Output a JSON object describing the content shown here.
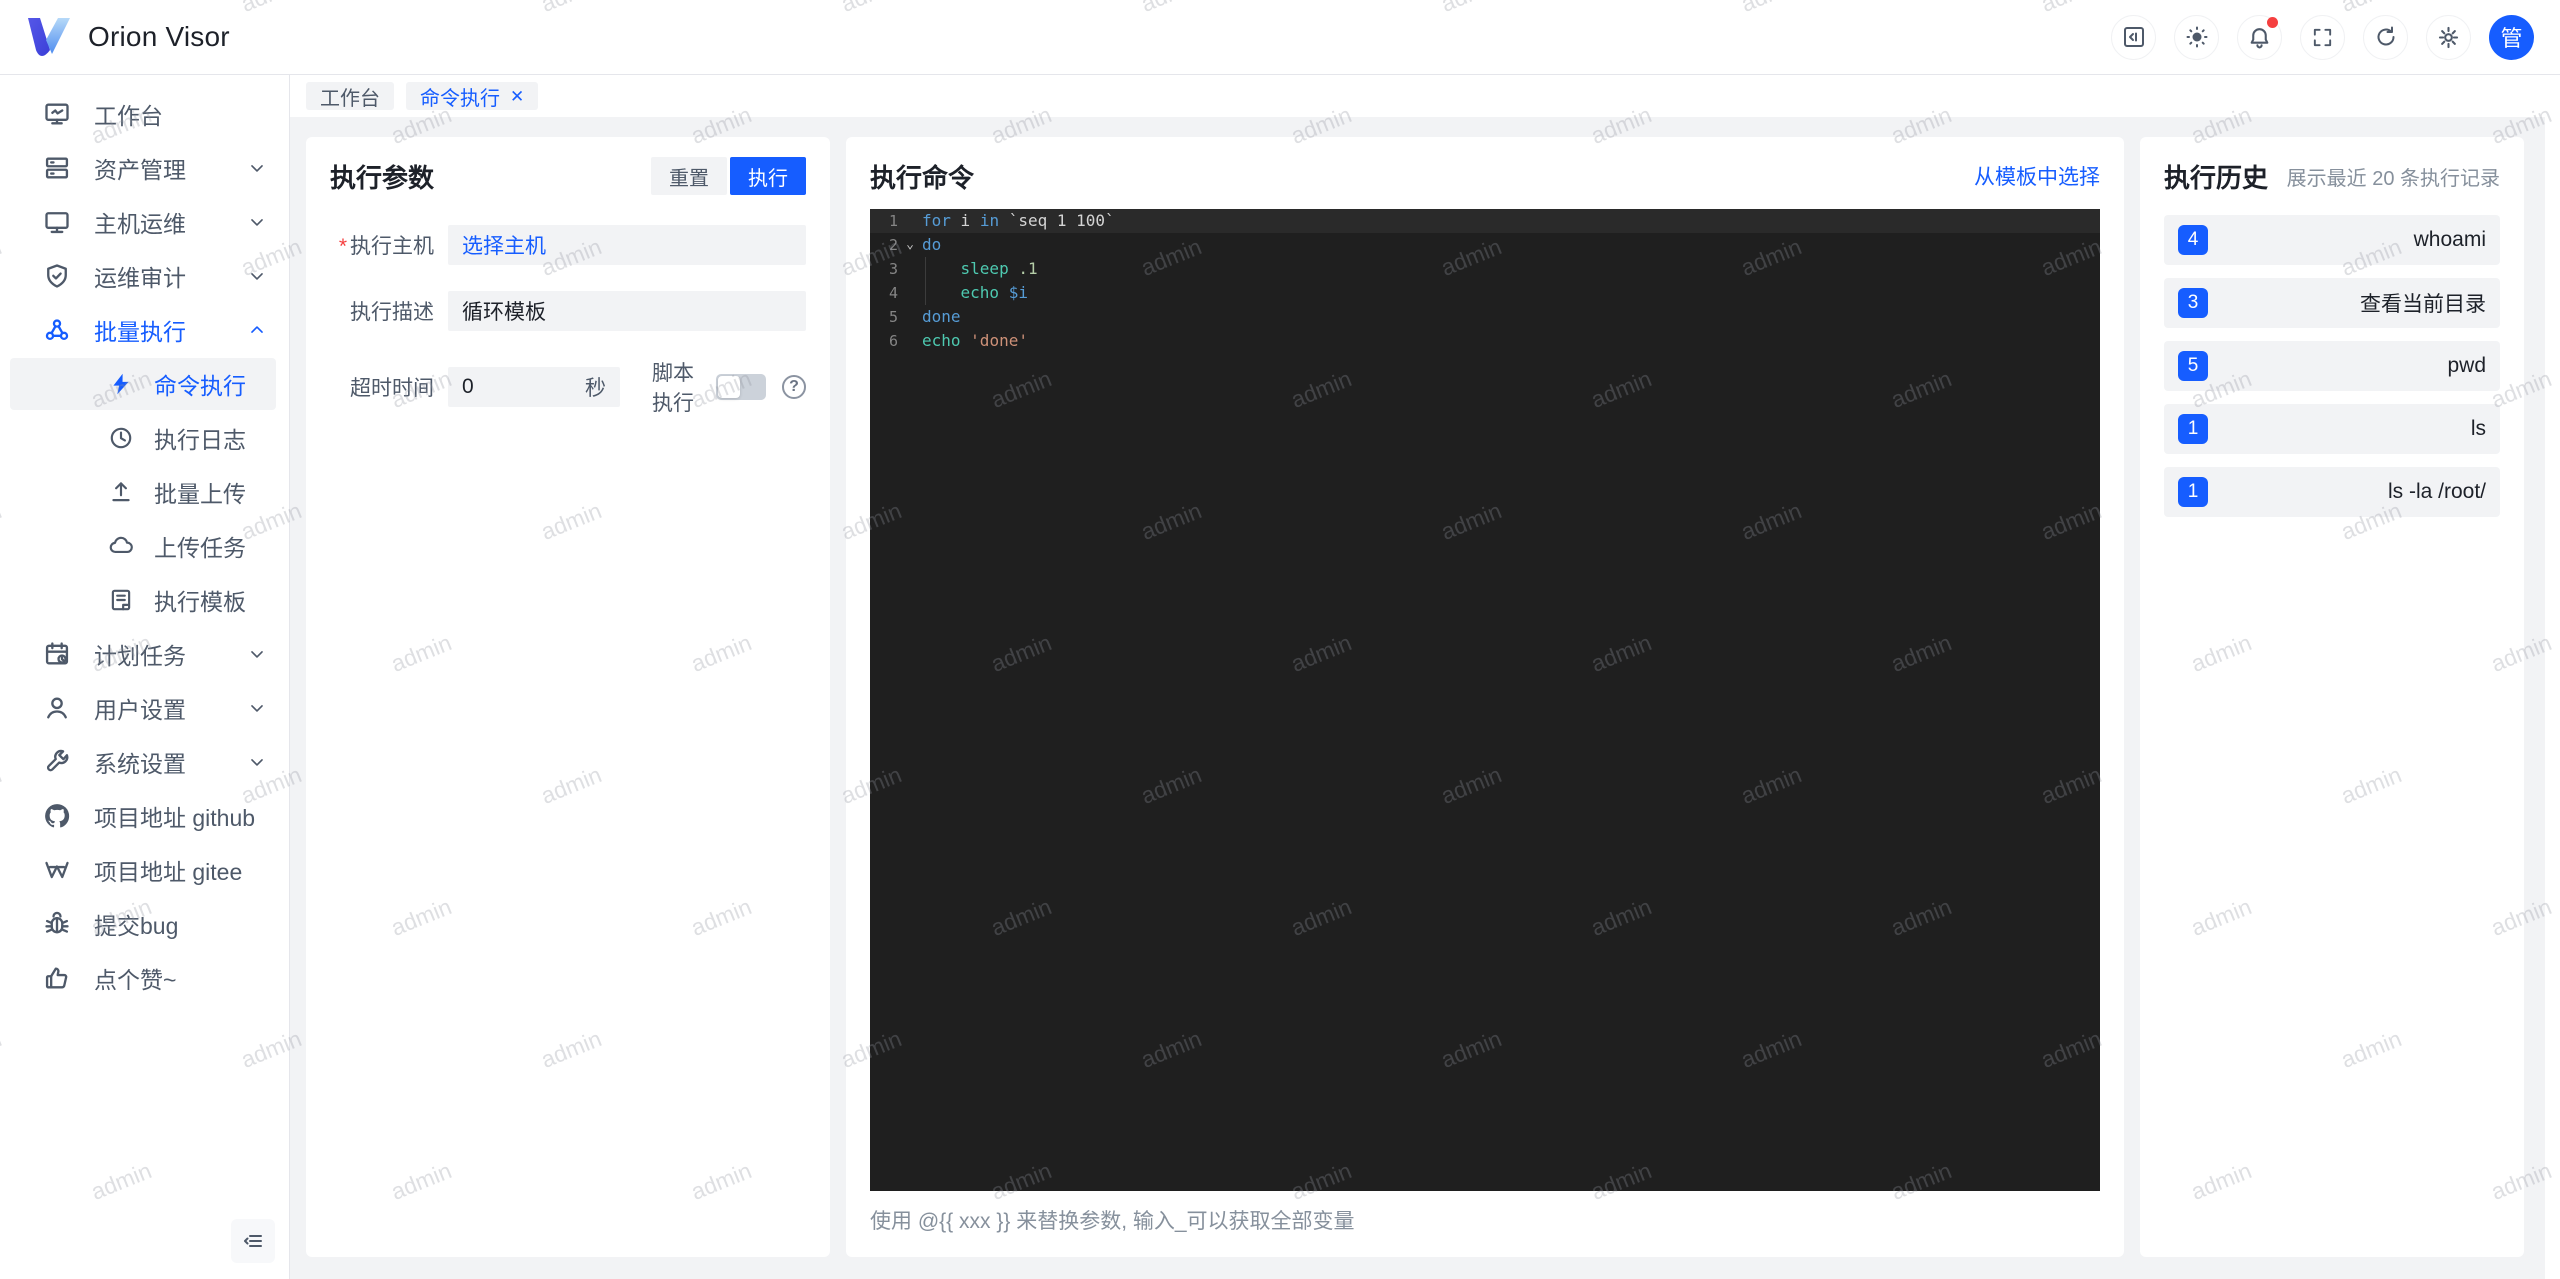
{
  "header": {
    "app_title": "Orion Visor",
    "icons": [
      "code-icon",
      "theme-icon",
      "bell-icon",
      "fullscreen-icon",
      "refresh-icon",
      "gear-icon"
    ],
    "notification_dot": true,
    "avatar_text": "管"
  },
  "tabs": [
    {
      "label": "工作台",
      "active": false,
      "closable": false
    },
    {
      "label": "命令执行",
      "active": true,
      "closable": true
    }
  ],
  "icons": {
    "close": "✕",
    "fold": "⌄",
    "help": "?"
  },
  "sidebar": {
    "items": [
      {
        "label": "工作台",
        "icon": "dashboard-icon"
      },
      {
        "label": "资产管理",
        "icon": "assets-icon",
        "chevron": "down"
      },
      {
        "label": "主机运维",
        "icon": "host-icon",
        "chevron": "down"
      },
      {
        "label": "运维审计",
        "icon": "audit-icon",
        "chevron": "down"
      },
      {
        "label": "批量执行",
        "icon": "batch-icon",
        "chevron": "up",
        "highlighted": true
      },
      {
        "label": "命令执行",
        "icon": "bolt-icon",
        "sub": true,
        "active": true
      },
      {
        "label": "执行日志",
        "icon": "history-icon",
        "sub": true
      },
      {
        "label": "批量上传",
        "icon": "upload-icon",
        "sub": true
      },
      {
        "label": "上传任务",
        "icon": "cloud-icon",
        "sub": true
      },
      {
        "label": "执行模板",
        "icon": "template-icon",
        "sub": true
      },
      {
        "label": "计划任务",
        "icon": "schedule-icon",
        "chevron": "down"
      },
      {
        "label": "用户设置",
        "icon": "user-icon",
        "chevron": "down"
      },
      {
        "label": "系统设置",
        "icon": "wrench-icon",
        "chevron": "down"
      },
      {
        "label": "项目地址 github",
        "icon": "github-icon"
      },
      {
        "label": "项目地址 gitee",
        "icon": "gitee-icon"
      },
      {
        "label": "提交bug",
        "icon": "bug-icon"
      },
      {
        "label": "点个赞~",
        "icon": "thumbs-up-icon"
      }
    ]
  },
  "params_panel": {
    "title": "执行参数",
    "reset_label": "重置",
    "run_label": "执行",
    "fields": {
      "host": {
        "label": "执行主机",
        "required": true,
        "value": "选择主机"
      },
      "desc": {
        "label": "执行描述",
        "value": "循环模板"
      },
      "timeout": {
        "label": "超时时间",
        "value": "0",
        "suffix": "秒"
      },
      "script": {
        "label": "脚本执行",
        "enabled": false
      }
    }
  },
  "command_panel": {
    "title": "执行命令",
    "template_link": "从模板中选择",
    "hint": "使用 @{{ xxx }} 来替换参数, 输入_可以获取全部变量",
    "editor": {
      "language": "shell",
      "lines": [
        {
          "num": "1",
          "tokens": [
            {
              "t": "for",
              "c": "kw"
            },
            {
              "t": " i ",
              "c": "pl"
            },
            {
              "t": "in",
              "c": "kw"
            },
            {
              "t": " `seq 1 100`",
              "c": "pl"
            }
          ]
        },
        {
          "num": "2",
          "fold": true,
          "tokens": [
            {
              "t": "do",
              "c": "kw"
            }
          ]
        },
        {
          "num": "3",
          "tokens": [
            {
              "t": "    ",
              "c": "pl"
            },
            {
              "t": "sleep",
              "c": "fn"
            },
            {
              "t": " ",
              "c": "pl"
            },
            {
              "t": ".1",
              "c": "num"
            }
          ]
        },
        {
          "num": "4",
          "tokens": [
            {
              "t": "    ",
              "c": "pl"
            },
            {
              "t": "echo",
              "c": "fn"
            },
            {
              "t": " ",
              "c": "pl"
            },
            {
              "t": "$i",
              "c": "var"
            }
          ]
        },
        {
          "num": "5",
          "tokens": [
            {
              "t": "done",
              "c": "kw"
            }
          ]
        },
        {
          "num": "6",
          "tokens": [
            {
              "t": "echo",
              "c": "fn"
            },
            {
              "t": " ",
              "c": "pl"
            },
            {
              "t": "'done'",
              "c": "str"
            }
          ]
        }
      ]
    }
  },
  "history_panel": {
    "title": "执行历史",
    "subtitle": "展示最近 20 条执行记录",
    "items": [
      {
        "count": "4",
        "command": "whoami"
      },
      {
        "count": "3",
        "command": "查看当前目录"
      },
      {
        "count": "5",
        "command": "pwd"
      },
      {
        "count": "1",
        "command": "ls"
      },
      {
        "count": "1",
        "command": "ls -la /root/"
      }
    ]
  },
  "watermark": {
    "text": "admin"
  },
  "colors": {
    "accent": "#165dff",
    "page_bg": "#f2f3f5",
    "panel_bg": "#ffffff",
    "text_primary": "#1d2129",
    "text_secondary": "#4e5969",
    "text_muted": "#86909c",
    "danger": "#f53f3f",
    "editor_bg": "#1f1f1f"
  }
}
